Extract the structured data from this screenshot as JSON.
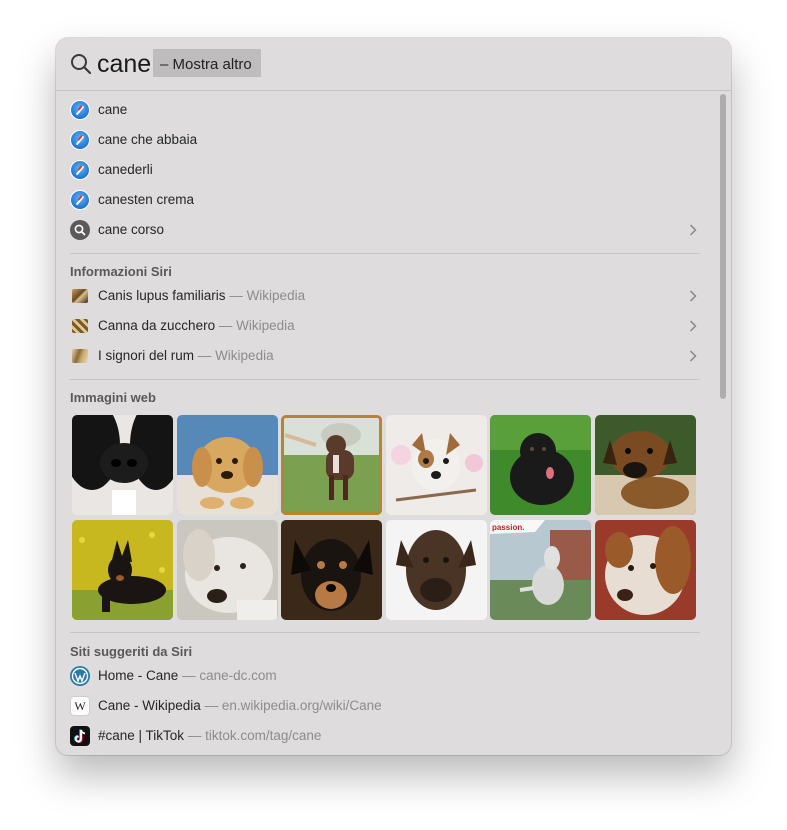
{
  "search": {
    "query": "cane",
    "hint": "– Mostra altro"
  },
  "suggestions": [
    {
      "label": "cane",
      "icon": "safari-icon"
    },
    {
      "label": "cane che abbaia",
      "icon": "safari-icon"
    },
    {
      "label": "canederli",
      "icon": "safari-icon"
    },
    {
      "label": "canesten crema",
      "icon": "safari-icon"
    },
    {
      "label": "cane corso",
      "icon": "search-icon"
    }
  ],
  "siri_info": {
    "title": "Informazioni Siri",
    "items": [
      {
        "label": "Canis lupus familiaris",
        "source": "— Wikipedia"
      },
      {
        "label": "Canna da zucchero",
        "source": "— Wikipedia"
      },
      {
        "label": "I signori del rum",
        "source": "— Wikipedia"
      }
    ]
  },
  "web_images": {
    "title": "Immagini web",
    "images": [
      {
        "name": "black-white-dog-nose",
        "colors": [
          "#141414",
          "#e9e6e3"
        ]
      },
      {
        "name": "golden-puppy",
        "colors": [
          "#d8a860",
          "#4a7fb0"
        ]
      },
      {
        "name": "dog-in-field",
        "colors": [
          "#6f9a46",
          "#5a3a2a"
        ]
      },
      {
        "name": "jack-russell",
        "colors": [
          "#e8e4e0",
          "#a06a3a"
        ]
      },
      {
        "name": "black-puppy-grass",
        "colors": [
          "#3f8a2a",
          "#1a1a1a"
        ]
      },
      {
        "name": "brown-puppy",
        "colors": [
          "#3c5a2a",
          "#7a4a22"
        ]
      },
      {
        "name": "doberman-flowers",
        "colors": [
          "#c8b820",
          "#1a1512"
        ]
      },
      {
        "name": "white-lab",
        "colors": [
          "#d6d2cc",
          "#e9e6e1"
        ]
      },
      {
        "name": "dachshund",
        "colors": [
          "#3a2818",
          "#b77a45"
        ]
      },
      {
        "name": "cane-corso-brown",
        "colors": [
          "#f4f4f4",
          "#4a3426"
        ]
      },
      {
        "name": "husky-howling",
        "colors": [
          "#6a8a5a",
          "#d8d8d8"
        ]
      },
      {
        "name": "brown-white-dog",
        "colors": [
          "#e8ddd2",
          "#9a5a2a"
        ]
      }
    ],
    "watermark": "passion."
  },
  "siri_sites": {
    "title": "Siti suggeriti da Siri",
    "items": [
      {
        "label": "Home - Cane",
        "source": "— cane-dc.com",
        "icon": "wordpress-icon"
      },
      {
        "label": "Cane - Wikipedia",
        "source": "— en.wikipedia.org/wiki/Cane",
        "icon": "wikipedia-icon",
        "icon_letter": "W"
      },
      {
        "label": "#cane | TikTok",
        "source": "— tiktok.com/tag/cane",
        "icon": "tiktok-icon"
      }
    ]
  },
  "colors": {
    "panel": "#dedcdc",
    "highlight": "#bebcbc",
    "selection": "#b8862a"
  }
}
